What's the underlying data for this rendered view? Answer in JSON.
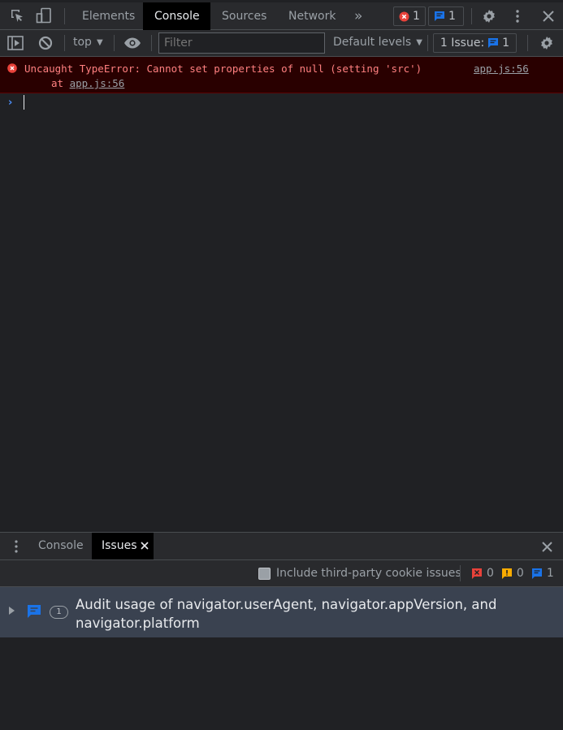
{
  "toolbar": {
    "tabs": [
      {
        "label": "Elements",
        "active": false
      },
      {
        "label": "Console",
        "active": true
      },
      {
        "label": "Sources",
        "active": false
      },
      {
        "label": "Network",
        "active": false
      }
    ],
    "more_tabs_glyph": "»",
    "error_count": "1",
    "issue_count": "1"
  },
  "console_toolbar": {
    "context": "top",
    "filter_placeholder": "Filter",
    "levels": "Default levels",
    "issues_label": "1 Issue:",
    "issues_count": "1"
  },
  "messages": [
    {
      "level": "error",
      "text": "Uncaught TypeError: Cannot set properties of null (setting 'src')",
      "source": "app.js:56",
      "stack_prefix": "at ",
      "stack_link": "app.js:56"
    }
  ],
  "prompt": {
    "glyph": "›"
  },
  "drawer": {
    "tabs": [
      {
        "label": "Console",
        "active": false
      },
      {
        "label": "Issues",
        "active": true
      }
    ],
    "include_third_party": "Include third-party cookie issues",
    "counts": {
      "errors": "0",
      "warnings": "0",
      "info": "1"
    },
    "issue": {
      "count": "1",
      "title": "Audit usage of navigator.userAgent, navigator.appVersion, and navigator.platform"
    }
  },
  "colors": {
    "error": "#f28b82",
    "info": "#1a73e8",
    "warning": "#f9ab00"
  }
}
